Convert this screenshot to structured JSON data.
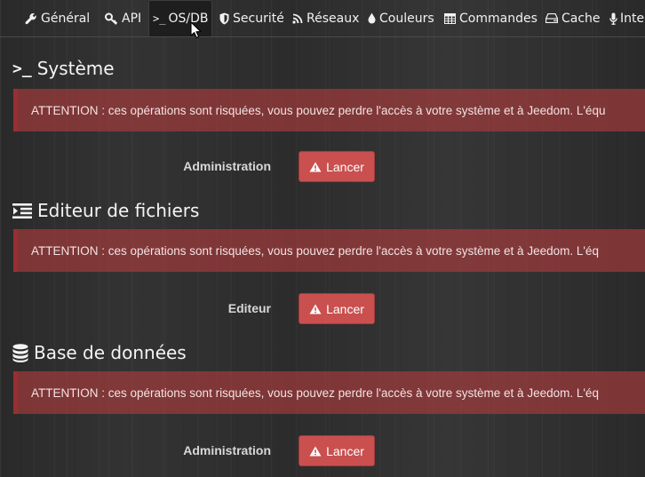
{
  "tabs": [
    {
      "label": "Général",
      "icon": "wrench-icon",
      "active": false
    },
    {
      "label": "API",
      "icon": "key-icon",
      "active": false
    },
    {
      "label": "OS/DB",
      "icon": "terminal-icon",
      "active": true
    },
    {
      "label": "Securité",
      "icon": "shield-icon",
      "active": false
    },
    {
      "label": "Réseaux",
      "icon": "rss-icon",
      "active": false
    },
    {
      "label": "Couleurs",
      "icon": "tint-icon",
      "active": false
    },
    {
      "label": "Commandes",
      "icon": "table-icon",
      "active": false
    },
    {
      "label": "Cache",
      "icon": "hdd-icon",
      "active": false
    },
    {
      "label": "Inte",
      "icon": "microphone-icon",
      "active": false
    }
  ],
  "sections": [
    {
      "title": "Système",
      "icon": "terminal-icon",
      "alert": "ATTENTION : ces opérations sont risquées, vous pouvez perdre l'accès à votre système et à Jeedom. L'équ",
      "row_label": "Administration",
      "button_label": "Lancer",
      "button_icon": "warning-icon"
    },
    {
      "title": "Editeur de fichiers",
      "icon": "indent-icon",
      "alert": "ATTENTION : ces opérations sont risquées, vous pouvez perdre l'accès à votre système et à Jeedom. L'éq",
      "row_label": "Editeur",
      "button_label": "Lancer",
      "button_icon": "warning-icon"
    },
    {
      "title": "Base de données",
      "icon": "database-icon",
      "alert": "ATTENTION : ces opérations sont risquées, vous pouvez perdre l'accès à votre système et à Jeedom. L'éq",
      "row_label": "Administration",
      "button_label": "Lancer",
      "button_icon": "warning-icon"
    }
  ],
  "colors": {
    "alert_bg": "#b23c3e",
    "alert_border": "#9b2e32",
    "button_bg": "#c9504f",
    "active_tab_bg": "#1e1e1e"
  }
}
